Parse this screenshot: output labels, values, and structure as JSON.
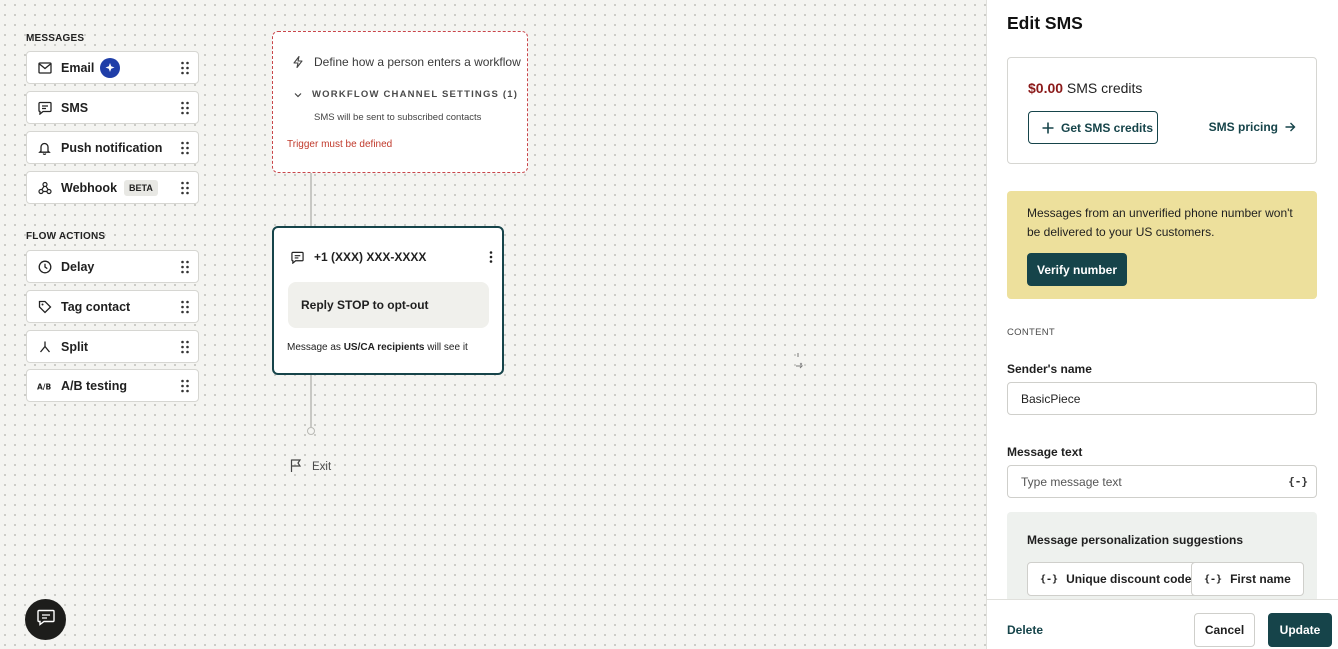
{
  "palette": {
    "messages_title": "MESSAGES",
    "messages": [
      {
        "label": "Email",
        "icon": "mail-icon"
      },
      {
        "label": "SMS",
        "icon": "chat-icon"
      },
      {
        "label": "Push notification",
        "icon": "bell-icon"
      },
      {
        "label": "Webhook",
        "icon": "webhook-icon",
        "badge": "BETA"
      }
    ],
    "flow_title": "FLOW ACTIONS",
    "flow_actions": [
      {
        "label": "Delay",
        "icon": "clock-icon"
      },
      {
        "label": "Tag contact",
        "icon": "tag-icon"
      },
      {
        "label": "Split",
        "icon": "split-icon"
      },
      {
        "label": "A/B testing",
        "icon": "ab-icon"
      }
    ]
  },
  "workflow": {
    "trigger": {
      "text": "Define how a person enters a workflow",
      "channel_settings": "WORKFLOW CHANNEL SETTINGS (1)",
      "channel_desc": "SMS will be sent to subscribed contacts",
      "error": "Trigger must be defined"
    },
    "sms_node": {
      "sender": "+1 (XXX) XXX-XXXX",
      "message": "Reply STOP to opt-out",
      "footer_prefix": "Message as ",
      "footer_bold": "US/CA recipients",
      "footer_suffix": " will see it"
    },
    "exit_label": "Exit"
  },
  "panel": {
    "title": "Edit SMS",
    "credits_amount": "$0.00",
    "credits_suffix": " SMS credits",
    "get_credits": "Get SMS credits",
    "pricing": "SMS pricing",
    "warning": "Messages from an unverified phone number won't be delivered to your US customers.",
    "verify": "Verify number",
    "content_label": "CONTENT",
    "sender_label": "Sender's name",
    "sender_value": "BasicPiece",
    "message_label": "Message text",
    "message_placeholder": "Type message text",
    "suggestions_title": "Message personalization suggestions",
    "chips": [
      "Unique discount code",
      "First name"
    ],
    "delete": "Delete",
    "cancel": "Cancel",
    "update": "Update"
  },
  "colors": {
    "brand": "#16444a",
    "error": "#c0392b",
    "warning_bg": "#ede09c",
    "credits": "#8b1a1a"
  }
}
